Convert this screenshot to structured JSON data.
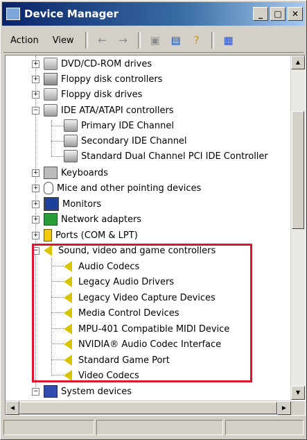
{
  "window": {
    "title": "Device Manager"
  },
  "titlebar_buttons": {
    "minimize": "_",
    "maximize": "□",
    "close": "✕"
  },
  "menu": {
    "action_label": "Action",
    "view_label": "View"
  },
  "toolbar": {
    "icons": [
      "back-arrow-icon",
      "forward-arrow-icon",
      "folder-up-icon",
      "properties-icon",
      "help-icon",
      "scan-hardware-icon"
    ]
  },
  "tree": {
    "nodes": [
      {
        "label": "DVD/CD-ROM drives",
        "expander": "+"
      },
      {
        "label": "Floppy disk controllers",
        "expander": "+"
      },
      {
        "label": "Floppy disk drives",
        "expander": "+"
      },
      {
        "label": "IDE ATA/ATAPI controllers",
        "expander": "−"
      },
      {
        "label": "Primary IDE Channel"
      },
      {
        "label": "Secondary IDE Channel"
      },
      {
        "label": "Standard Dual Channel PCI IDE Controller"
      },
      {
        "label": "Keyboards",
        "expander": "+"
      },
      {
        "label": "Mice and other pointing devices",
        "expander": "+"
      },
      {
        "label": "Monitors",
        "expander": "+"
      },
      {
        "label": "Network adapters",
        "expander": "+"
      },
      {
        "label": "Ports (COM & LPT)",
        "expander": "+"
      },
      {
        "label": "Sound, video and game controllers",
        "expander": "−"
      },
      {
        "label": "Audio Codecs"
      },
      {
        "label": "Legacy Audio Drivers"
      },
      {
        "label": "Legacy Video Capture Devices"
      },
      {
        "label": "Media Control Devices"
      },
      {
        "label": "MPU-401 Compatible MIDI Device"
      },
      {
        "label": "NVIDIA® Audio Codec Interface"
      },
      {
        "label": "Standard Game Port"
      },
      {
        "label": "Video Codecs"
      },
      {
        "label": "System devices",
        "expander": "−"
      }
    ]
  },
  "colors": {
    "highlight": "#e0142a",
    "titlebar": "#0a246a"
  }
}
